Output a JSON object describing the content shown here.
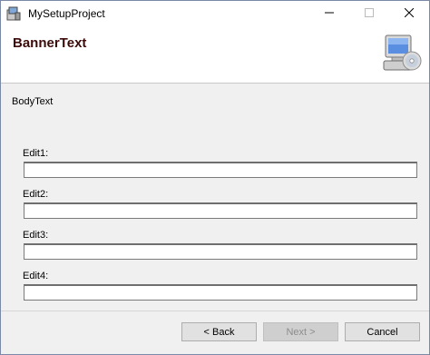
{
  "window": {
    "title": "MySetupProject"
  },
  "banner": {
    "title": "BannerText"
  },
  "body": {
    "text": "BodyText"
  },
  "fields": [
    {
      "label": "Edit1:",
      "value": ""
    },
    {
      "label": "Edit2:",
      "value": ""
    },
    {
      "label": "Edit3:",
      "value": ""
    },
    {
      "label": "Edit4:",
      "value": ""
    }
  ],
  "buttons": {
    "back": "< Back",
    "next": "Next >",
    "cancel": "Cancel"
  },
  "icons": {
    "app": "installer-icon",
    "banner": "computer-disc-icon",
    "minimize": "minimize-icon",
    "maximize": "maximize-icon",
    "close": "close-icon"
  }
}
